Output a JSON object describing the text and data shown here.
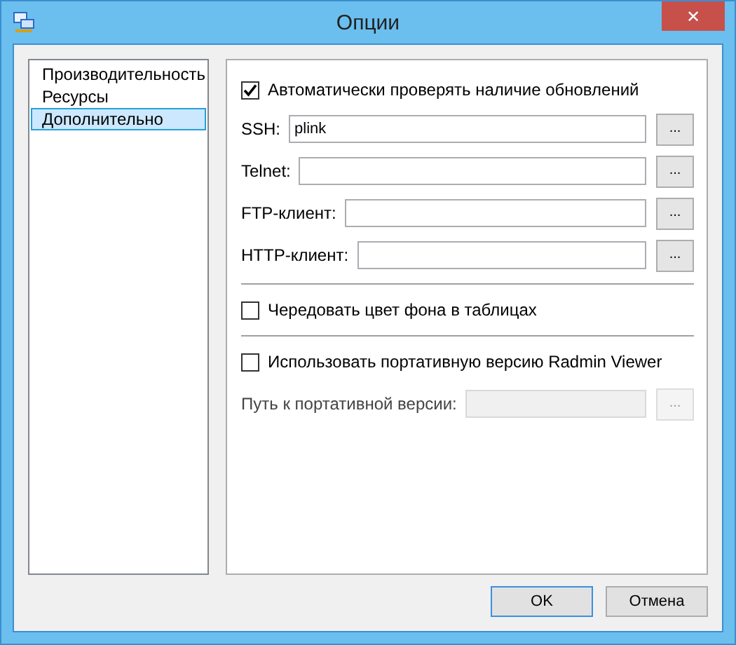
{
  "window": {
    "title": "Опции",
    "close": "✕"
  },
  "sidebar": {
    "items": [
      {
        "label": "Производительность",
        "selected": false
      },
      {
        "label": "Ресурсы",
        "selected": false
      },
      {
        "label": "Дополнительно",
        "selected": true
      }
    ]
  },
  "panel": {
    "auto_update": {
      "label": "Автоматически проверять наличие обновлений",
      "checked": true
    },
    "fields": [
      {
        "label": "SSH:",
        "value": "plink",
        "browse": "..."
      },
      {
        "label": "Telnet:",
        "browse": "..."
      },
      {
        "label": "FTP-клиент:",
        "browse": "..."
      },
      {
        "label": "HTTP-клиент:",
        "browse": "..."
      }
    ],
    "alternate_colors": {
      "label": "Чередовать цвет фона в таблицах",
      "checked": false
    },
    "portable": {
      "label": "Использовать портативную версию Radmin Viewer",
      "checked": false
    },
    "portable_path": {
      "label": "Путь к портативной версии:",
      "browse": "...",
      "disabled": true
    }
  },
  "buttons": [
    {
      "label": "OK",
      "default": true
    },
    {
      "label": "Отмена",
      "default": false
    }
  ]
}
